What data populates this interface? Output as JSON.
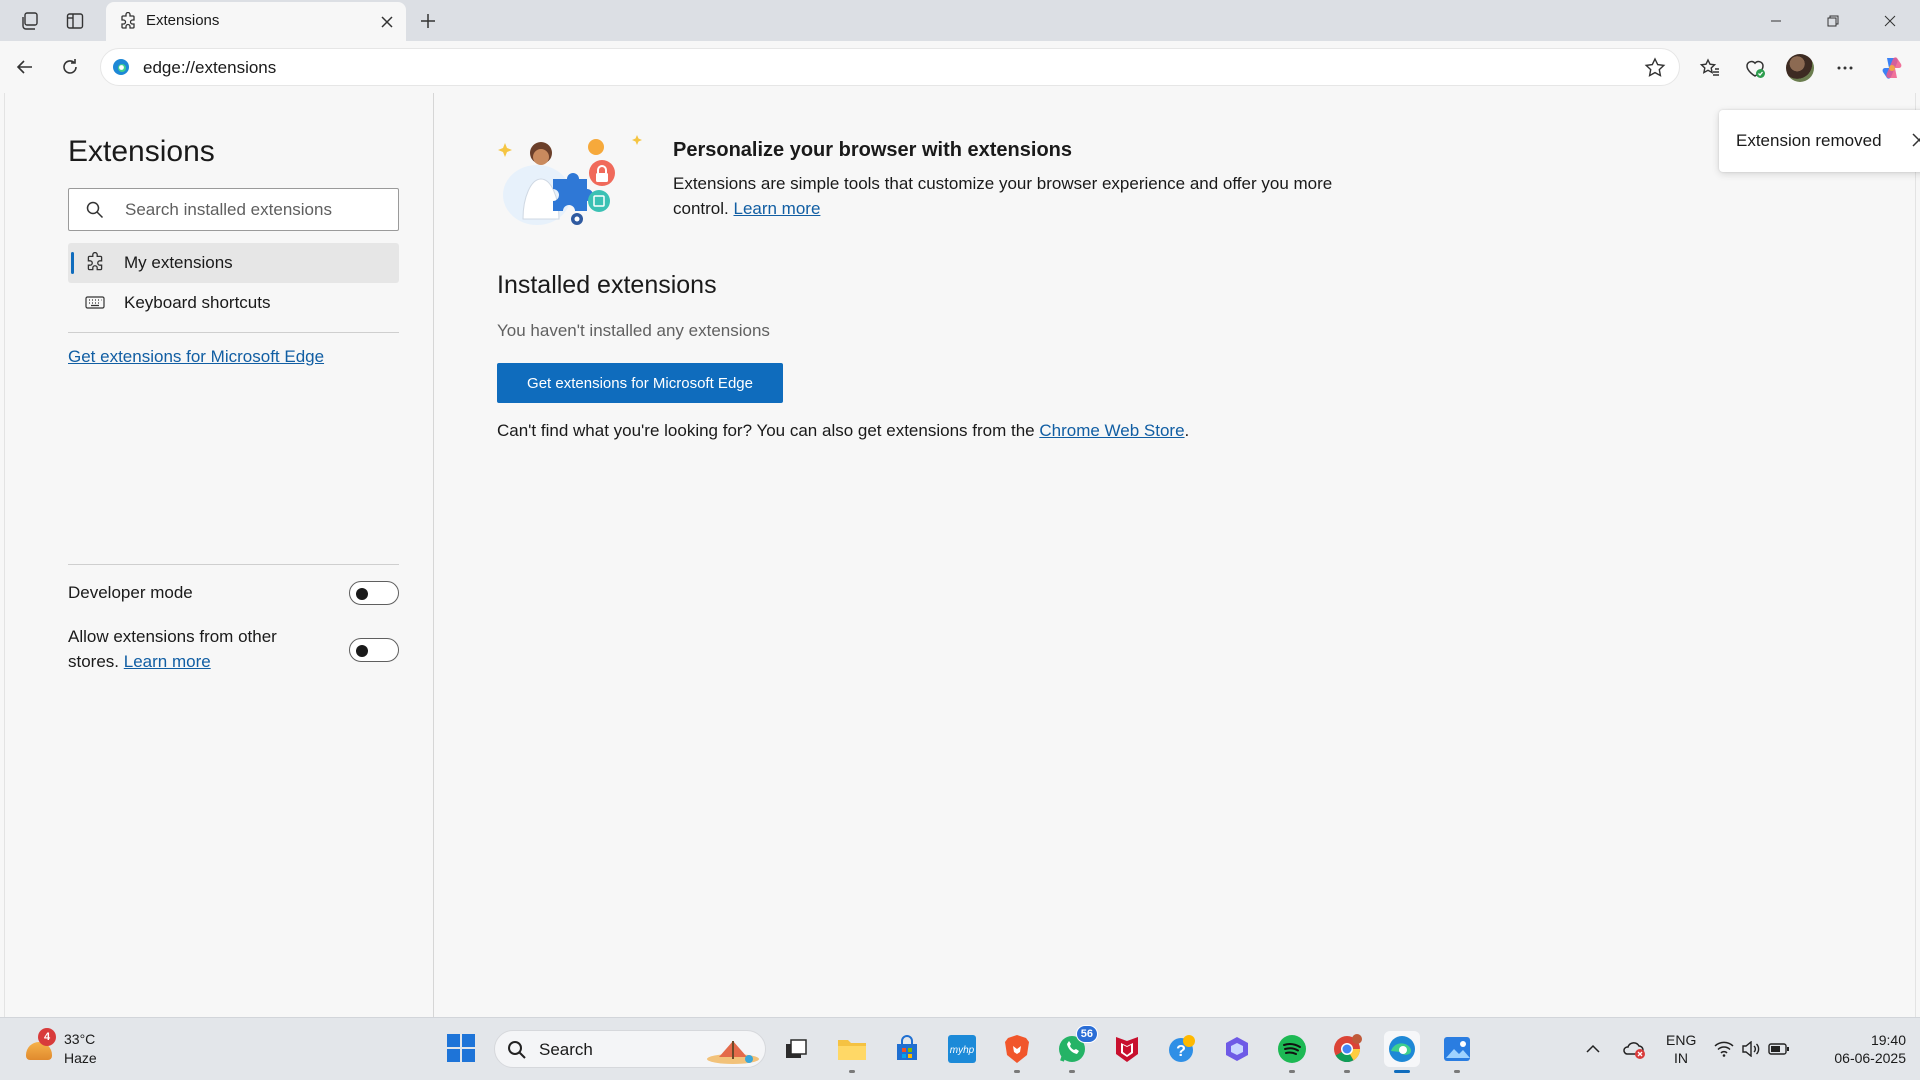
{
  "browser": {
    "tab": {
      "title": "Extensions"
    },
    "address_bar": {
      "url": "edge://extensions"
    }
  },
  "sidebar": {
    "title": "Extensions",
    "search": {
      "placeholder": "Search installed extensions",
      "value": ""
    },
    "nav": [
      {
        "label": "My extensions",
        "icon": "extension-icon",
        "active": true
      },
      {
        "label": "Keyboard shortcuts",
        "icon": "keyboard-icon",
        "active": false
      }
    ],
    "get_extensions_link": "Get extensions for Microsoft Edge",
    "developer_mode": {
      "label": "Developer mode",
      "enabled": false
    },
    "other_stores": {
      "label_prefix": "Allow extensions from other stores.",
      "link": "Learn more",
      "enabled": false
    }
  },
  "main": {
    "hero": {
      "title": "Personalize your browser with extensions",
      "description": "Extensions are simple tools that customize your browser experience and offer you more control.",
      "learn_more": "Learn more"
    },
    "installed": {
      "title": "Installed extensions",
      "empty_text": "You haven't installed any extensions",
      "get_button": "Get extensions for Microsoft Edge",
      "footer_prefix": "Can't find what you're looking for? You can also get extensions from the",
      "footer_link": "Chrome Web Store",
      "footer_suffix": "."
    }
  },
  "toast": {
    "text": "Extension removed"
  },
  "taskbar": {
    "weather": {
      "badge": "4",
      "temperature": "33°C",
      "condition": "Haze"
    },
    "search_label": "Search",
    "whatsapp_badge": "56",
    "tray": {
      "lang_line1": "ENG",
      "lang_line2": "IN",
      "time": "19:40",
      "date": "06-06-2025"
    }
  },
  "colors": {
    "accent": "#0f6cbd",
    "link": "#115ea3",
    "page_bg": "#f7f7f7"
  }
}
